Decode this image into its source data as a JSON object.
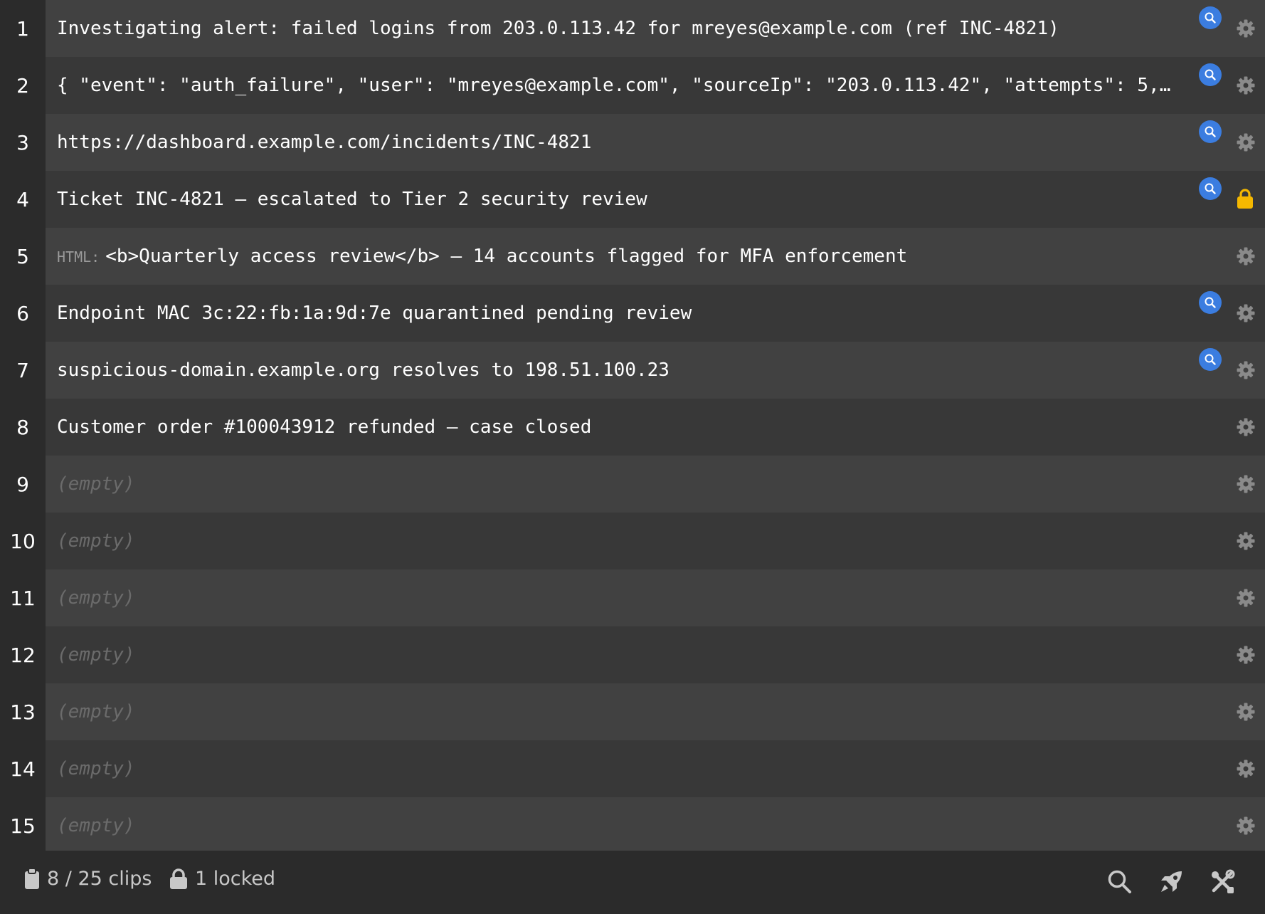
{
  "clips": [
    {
      "num": "1",
      "text": "Investigating alert: failed logins from 203.0.113.42 for mreyes@example.com (ref INC-4821)",
      "search": true,
      "locked": false,
      "prefix": ""
    },
    {
      "num": "2",
      "text": "{ \"event\": \"auth_failure\", \"user\": \"mreyes@example.com\", \"sourceIp\": \"203.0.113.42\", \"attempts\": 5, \"ti…",
      "search": true,
      "locked": false,
      "prefix": ""
    },
    {
      "num": "3",
      "text": "https://dashboard.example.com/incidents/INC-4821",
      "search": true,
      "locked": false,
      "prefix": ""
    },
    {
      "num": "4",
      "text": "Ticket INC-4821 — escalated to Tier 2 security review",
      "search": true,
      "locked": true,
      "prefix": ""
    },
    {
      "num": "5",
      "text": "<b>Quarterly access review</b> — 14 accounts flagged for MFA enforcement",
      "search": false,
      "locked": false,
      "prefix": "HTML:"
    },
    {
      "num": "6",
      "text": "Endpoint MAC 3c:22:fb:1a:9d:7e quarantined pending review",
      "search": true,
      "locked": false,
      "prefix": ""
    },
    {
      "num": "7",
      "text": "suspicious-domain.example.org resolves to 198.51.100.23",
      "search": true,
      "locked": false,
      "prefix": ""
    },
    {
      "num": "8",
      "text": "Customer order #100043912 refunded — case closed",
      "search": false,
      "locked": false,
      "prefix": ""
    },
    {
      "num": "9",
      "text": "(empty)",
      "empty": true,
      "search": false,
      "locked": false,
      "prefix": ""
    },
    {
      "num": "10",
      "text": "(empty)",
      "empty": true,
      "search": false,
      "locked": false,
      "prefix": ""
    },
    {
      "num": "11",
      "text": "(empty)",
      "empty": true,
      "search": false,
      "locked": false,
      "prefix": ""
    },
    {
      "num": "12",
      "text": "(empty)",
      "empty": true,
      "search": false,
      "locked": false,
      "prefix": ""
    },
    {
      "num": "13",
      "text": "(empty)",
      "empty": true,
      "search": false,
      "locked": false,
      "prefix": ""
    },
    {
      "num": "14",
      "text": "(empty)",
      "empty": true,
      "search": false,
      "locked": false,
      "prefix": ""
    },
    {
      "num": "15",
      "text": "(empty)",
      "empty": true,
      "search": false,
      "locked": false,
      "prefix": ""
    }
  ],
  "footer": {
    "clips_count": "8 / 25 clips",
    "locked_count": "1 locked",
    "clip_icon": "clipboard-icon",
    "lock_icon": "lock-icon",
    "actions": [
      "search-icon",
      "rocket-icon",
      "tools-icon"
    ]
  },
  "colors": {
    "search_badge": "#3b7de0",
    "lock": "#f5b800",
    "gear": "#8a8a8a"
  }
}
